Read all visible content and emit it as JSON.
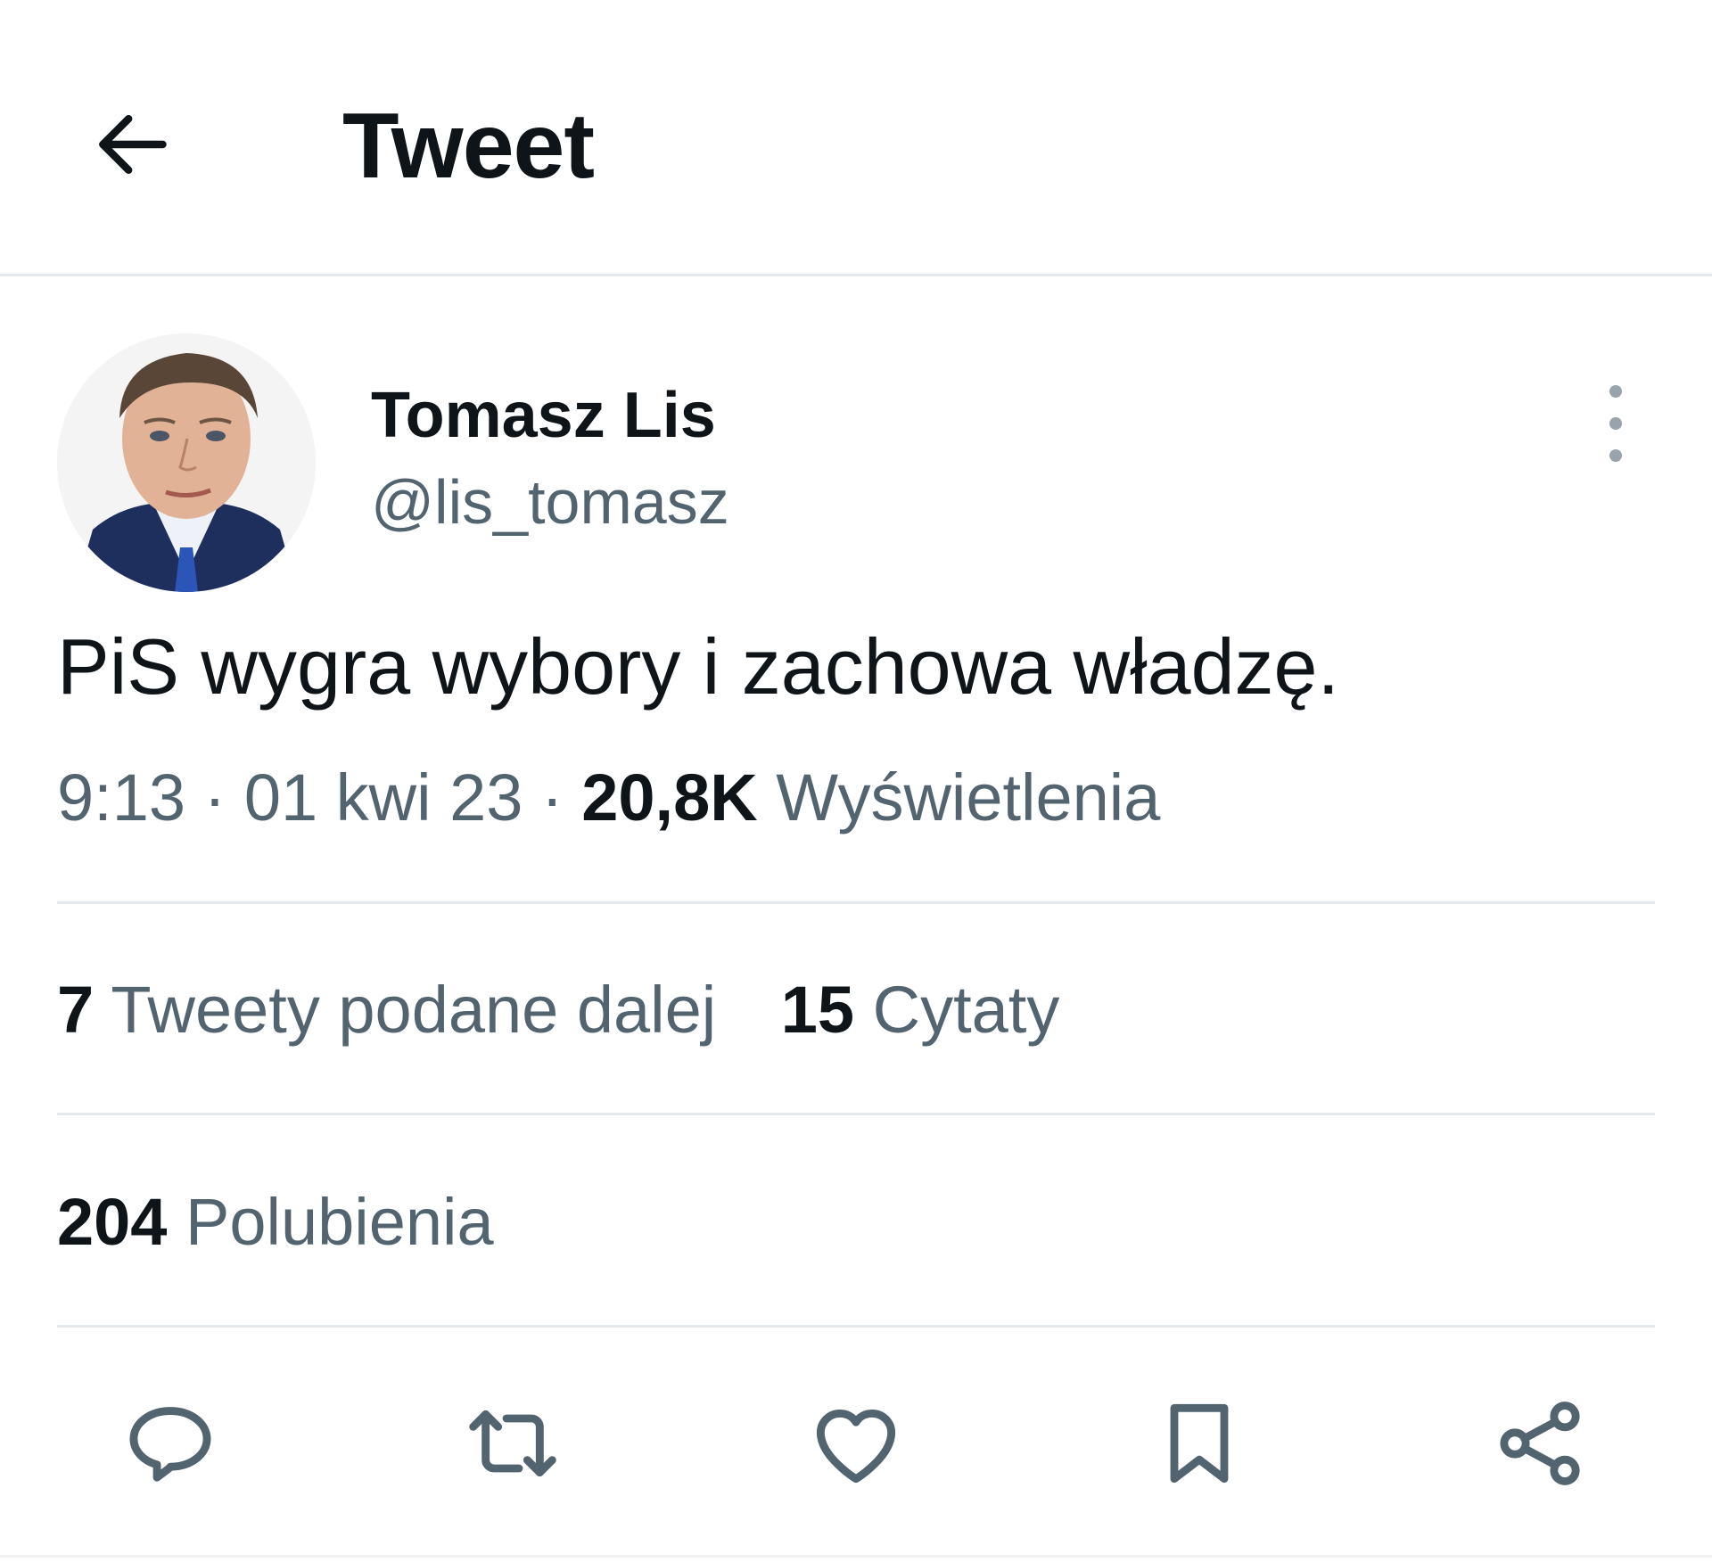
{
  "header": {
    "title": "Tweet",
    "back_icon": "arrow-left-icon"
  },
  "author": {
    "display_name": "Tomasz Lis",
    "handle": "@lis_tomasz"
  },
  "tweet": {
    "text": "PiS wygra wybory i zachowa władzę.",
    "time": "9:13",
    "separator": "·",
    "date": "01 kwi 23",
    "views_count": "20,8K",
    "views_label": "Wyświetlenia"
  },
  "stats": {
    "retweets_count": "7",
    "retweets_label": "Tweety podane dalej",
    "quotes_count": "15",
    "quotes_label": "Cytaty",
    "likes_count": "204",
    "likes_label": "Polubienia"
  },
  "actions": [
    {
      "icon": "reply-icon"
    },
    {
      "icon": "retweet-icon"
    },
    {
      "icon": "heart-icon"
    },
    {
      "icon": "bookmark-icon"
    },
    {
      "icon": "share-icon"
    }
  ],
  "colors": {
    "text_primary": "#0f1419",
    "text_secondary": "#536471",
    "divider": "#e6e9ec",
    "icon": "#536471"
  }
}
